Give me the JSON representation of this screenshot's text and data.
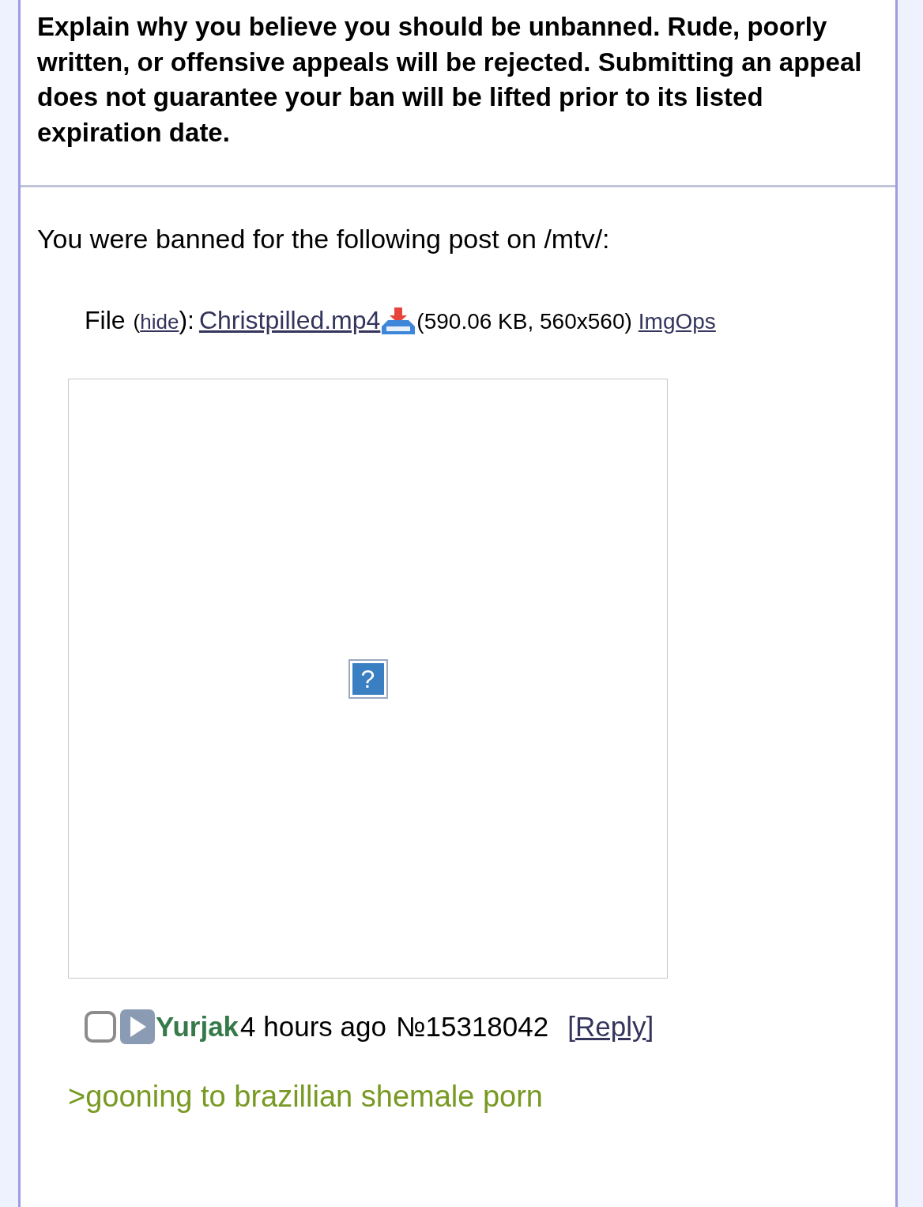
{
  "notice": "Explain why you believe you should be unbanned. Rude, poorly written, or offensive appeals will be rejected. Submitting an appeal does not guarantee your ban will be lifted prior to its listed expiration date.",
  "banned_for": "You were banned for the following post on /mtv/:",
  "file": {
    "label": "File",
    "hide_open": "(",
    "hide": "hide",
    "hide_close": "):",
    "name": "Christpilled.mp4",
    "info": "(590.06 KB, 560x560)",
    "imgops": "ImgOps"
  },
  "thumbnail": {
    "broken_glyph": "?"
  },
  "post": {
    "checked": false,
    "name": "Yurjak",
    "time": "4 hours ago",
    "number": "№15318042",
    "reply_open": "[",
    "reply": "Reply",
    "reply_close": "]"
  },
  "comment": [
    {
      "kind": "quote",
      "text": ">gooning to brazillian shemale porn"
    }
  ]
}
